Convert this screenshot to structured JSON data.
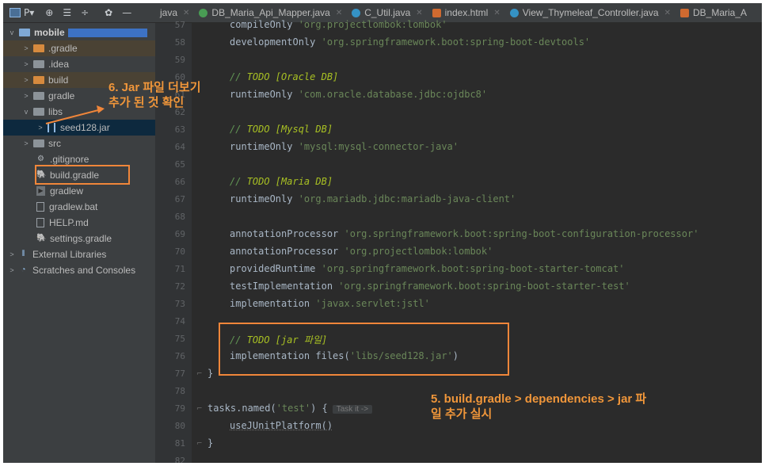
{
  "toolbar": {
    "project_label": "P▾",
    "icons": [
      "add-config-icon",
      "collapse-icon",
      "expand-icon",
      "gear-icon",
      "minimize-icon"
    ]
  },
  "tabs": [
    {
      "label": "java",
      "color": ""
    },
    {
      "label": "DB_Maria_Api_Mapper.java",
      "color": "#499c54"
    },
    {
      "label": "C_Util.java",
      "color": "#3592c4"
    },
    {
      "label": "index.html",
      "color": "#cf6a30"
    },
    {
      "label": "View_Thymeleaf_Controller.java",
      "color": "#3592c4"
    },
    {
      "label": "DB_Maria_A",
      "color": "#cf6a30"
    }
  ],
  "tree": {
    "root": "mobile",
    "items": [
      {
        "label": ".gradle",
        "type": "folder-orange",
        "arrow": ">"
      },
      {
        "label": ".idea",
        "type": "folder",
        "arrow": ">"
      },
      {
        "label": "build",
        "type": "folder-orange",
        "arrow": ">"
      },
      {
        "label": "gradle",
        "type": "folder",
        "arrow": ">"
      },
      {
        "label": "libs",
        "type": "folder",
        "arrow": "v"
      },
      {
        "label": "seed128.jar",
        "type": "jar",
        "arrow": ">"
      },
      {
        "label": "src",
        "type": "folder",
        "arrow": ">"
      },
      {
        "label": ".gitignore",
        "type": "file"
      },
      {
        "label": "build.gradle",
        "type": "gradle"
      },
      {
        "label": "gradlew",
        "type": "file"
      },
      {
        "label": "gradlew.bat",
        "type": "file"
      },
      {
        "label": "HELP.md",
        "type": "file"
      },
      {
        "label": "settings.gradle",
        "type": "gradle"
      },
      {
        "label": "External Libraries",
        "type": "lib",
        "arrow": ">"
      },
      {
        "label": "Scratches and Consoles",
        "type": "scratch",
        "arrow": ">"
      }
    ]
  },
  "line_numbers": [
    "57",
    "58",
    "59",
    "60",
    "61",
    "62",
    "63",
    "64",
    "65",
    "66",
    "67",
    "68",
    "69",
    "70",
    "71",
    "72",
    "73",
    "74",
    "75",
    "76",
    "77",
    "78",
    "79",
    "80",
    "81",
    "82"
  ],
  "code": {
    "l57a": "compileOnly ",
    "l57b": "'org.projectlombok:lombok'",
    "l58a": "developmentOnly ",
    "l58b": "'org.springframework.boot:spring-boot-devtools'",
    "l60a": "// ",
    "l60b": "TODO [Oracle DB]",
    "l61a": "runtimeOnly ",
    "l61b": "'com.oracle.database.jdbc:ojdbc8'",
    "l63a": "// ",
    "l63b": "TODO [Mysql DB]",
    "l64a": "runtimeOnly ",
    "l64b": "'mysql:mysql-connector-java'",
    "l66a": "// ",
    "l66b": "TODO [Maria DB]",
    "l67a": "runtimeOnly ",
    "l67b": "'org.mariadb.jdbc:mariadb-java-client'",
    "l69a": "annotationProcessor ",
    "l69b": "'org.springframework.boot:spring-boot-configuration-processor'",
    "l70a": "annotationProcessor ",
    "l70b": "'org.projectlombok:lombok'",
    "l71a": "providedRuntime ",
    "l71b": "'org.springframework.boot:spring-boot-starter-tomcat'",
    "l72a": "testImplementation ",
    "l72b": "'org.springframework.boot:spring-boot-starter-test'",
    "l73a": "implementation ",
    "l73b": "'javax.servlet:jstl'",
    "l75a": "// ",
    "l75b": "TODO [jar 파일]",
    "l76a": "implementation files(",
    "l76b": "'libs/seed128.jar'",
    "l76c": ")",
    "l77": "}",
    "l79a": "tasks.named(",
    "l79b": "'test'",
    "l79c": ") {",
    "l79hint": "Task it ->",
    "l80": "useJUnitPlatform()",
    "l81": "}"
  },
  "annotations": {
    "note6_line1": "6. Jar 파일 더보기",
    "note6_line2": "추가 된 것 확인",
    "note5_line1": "5. build.gradle > dependencies > jar 파",
    "note5_line2": "일 추가 실시",
    "color": "#f0863a"
  }
}
